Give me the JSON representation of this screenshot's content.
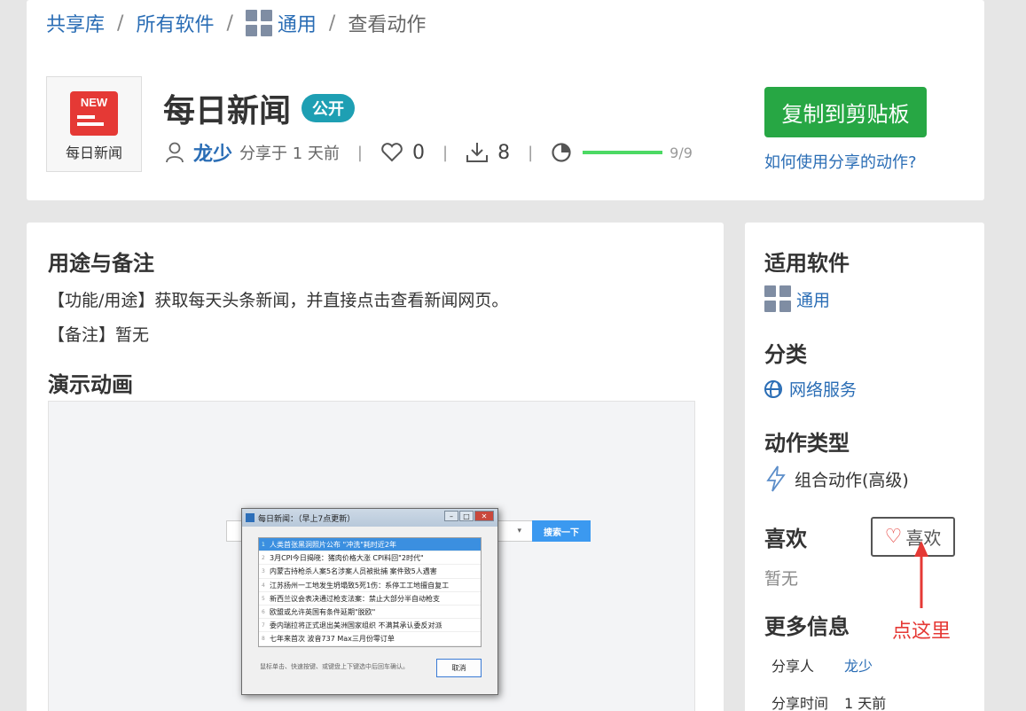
{
  "breadcrumb": {
    "home": "共享库",
    "all": "所有软件",
    "category": "通用",
    "current": "查看动作",
    "sep": "/"
  },
  "app": {
    "logo_text": "NEW",
    "logo_label": "每日新闻",
    "title": "每日新闻",
    "badge": "公开",
    "author": "龙少",
    "shared_time": "分享于 1 天前",
    "likes": "0",
    "downloads": "8",
    "progress_text": "9/9",
    "progress": 1.0,
    "separator": "|"
  },
  "actions": {
    "copy_label": "复制到剪贴板",
    "help_link": "如何使用分享的动作?"
  },
  "main": {
    "usage_title": "用途与备注",
    "usage_desc": "【功能/用途】获取每天头条新闻，并直接点击查看新闻网页。",
    "notes": "【备注】暂无",
    "demo_title": "演示动画",
    "demo": {
      "window_title": "每日新闻：（早上7点更新）",
      "search_label": "搜索一下",
      "items": [
        "人类首张黑洞照片公布 \"冲洗\"耗时近2年",
        "3月CPI今日揭晓：猪肉价格大涨 CPI料回\"2时代\"",
        "内蒙古持枪杀人案5名涉案人员被批捕 案件致5人遇害",
        "江苏扬州一工地发生坍塌致5死1伤：系停工工地擅自复工",
        "新西兰议会表决通过枪支法案：禁止大部分半自动枪支",
        "欧盟或允许英国有条件延期\"脱欧\"",
        "委内瑞拉将正式退出美洲国家组织 不满其承认委反对派",
        "七年来首次 波音737 Max三月份零订单"
      ],
      "hint": "鼠标单击、快速按键、或键盘上下键选中后回车确认。",
      "cancel": "取消"
    }
  },
  "side": {
    "software_title": "适用软件",
    "software": "通用",
    "category_title": "分类",
    "category": "网络服务",
    "type_title": "动作类型",
    "type": "组合动作(高级)",
    "like_title": "喜欢",
    "like_btn": "喜欢",
    "like_none": "暂无",
    "more_title": "更多信息",
    "sharer_label": "分享人",
    "sharer": "龙少",
    "time_label": "分享时间",
    "time": "1 天前"
  },
  "annotation": {
    "text": "点这里",
    "color": "#e53935"
  },
  "colors": {
    "accent": "#2a6db5",
    "green": "#27a744",
    "badge": "#1e9fb3"
  }
}
